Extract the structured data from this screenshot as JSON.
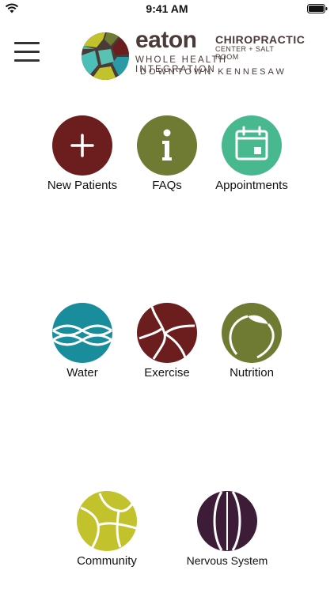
{
  "status_bar": {
    "time": "9:41 AM"
  },
  "header": {
    "brand": {
      "name": "eaton",
      "title": "CHIROPRACTIC",
      "subtitle": "CENTER + SALT ROOM",
      "tagline": "WHOLE HEALTH INTEGRATION",
      "location": "DOWNTOWN KENNESAW"
    }
  },
  "tiles": [
    {
      "label": "New Patients",
      "icon": "plus-icon",
      "color": "#6b1e1d"
    },
    {
      "label": "FAQs",
      "icon": "info-icon",
      "color": "#6f7b33"
    },
    {
      "label": "Appointments",
      "icon": "calendar-icon",
      "color": "#48b88f"
    },
    {
      "label": "Water",
      "icon": "water-waves-icon",
      "color": "#1a8d9d"
    },
    {
      "label": "Exercise",
      "icon": "exercise-icon",
      "color": "#6b1e1d"
    },
    {
      "label": "Nutrition",
      "icon": "nutrition-leaf-icon",
      "color": "#6f7b33"
    },
    {
      "label": "Community",
      "icon": "community-icon",
      "color": "#c2c22d"
    },
    {
      "label": "Nervous System",
      "icon": "nervous-system-icon",
      "color": "#3c1c36"
    }
  ]
}
